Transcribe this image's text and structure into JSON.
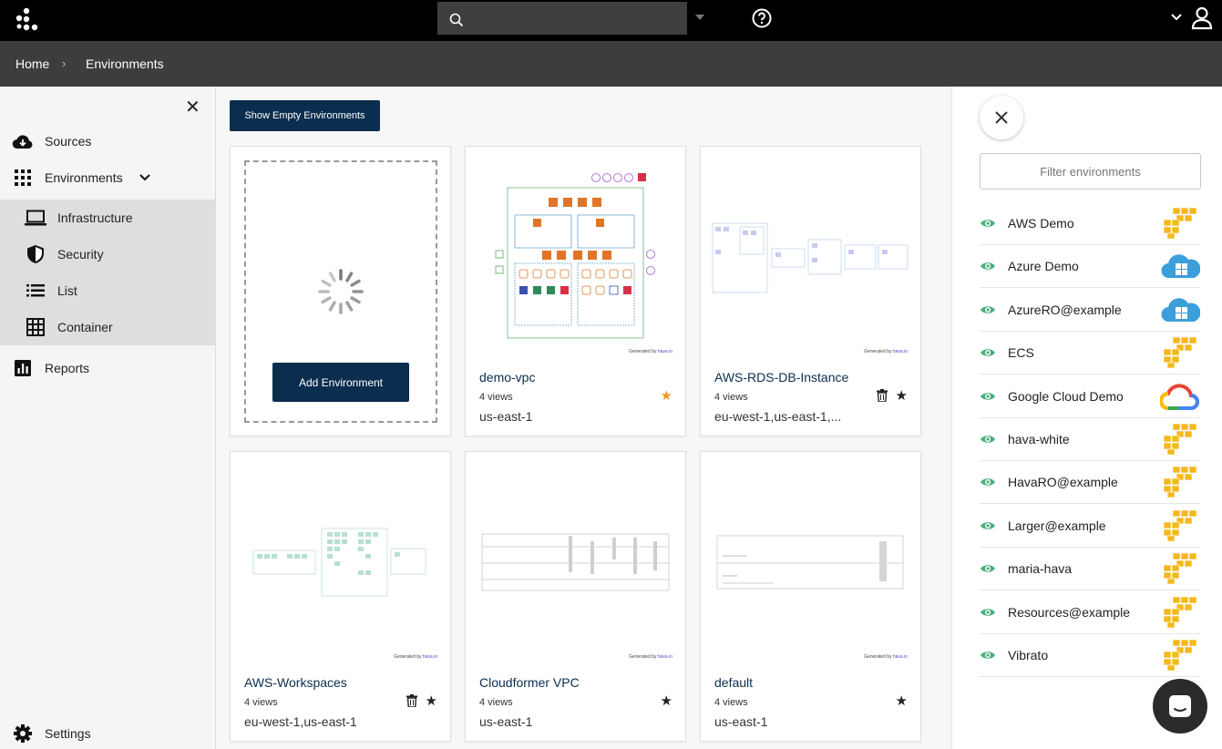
{
  "breadcrumb": {
    "home": "Home",
    "separator": "›",
    "current": "Environments"
  },
  "sidebar": {
    "items": [
      {
        "label": "Sources",
        "icon": "cloud-download-icon"
      },
      {
        "label": "Environments",
        "icon": "grid-icon"
      },
      {
        "label": "Infrastructure",
        "icon": "laptop-icon"
      },
      {
        "label": "Security",
        "icon": "shield-icon"
      },
      {
        "label": "List",
        "icon": "list-icon"
      },
      {
        "label": "Container",
        "icon": "container-grid-icon"
      },
      {
        "label": "Reports",
        "icon": "report-icon"
      },
      {
        "label": "Settings",
        "icon": "gear-icon"
      }
    ]
  },
  "toolbar": {
    "show_empty_label": "Show Empty Environments"
  },
  "add_card": {
    "button_label": "Add Environment"
  },
  "generated_by": {
    "prefix": "Generated by",
    "brand": "hava.io"
  },
  "cards": [
    {
      "name": "demo-vpc",
      "views": "4 views",
      "region": "us-east-1",
      "starred": true,
      "deletable": false
    },
    {
      "name": "AWS-RDS-DB-Instance",
      "views": "4 views",
      "region": "eu-west-1,us-east-1,...",
      "starred": false,
      "deletable": true
    },
    {
      "name": "AWS-Workspaces",
      "views": "4 views",
      "region": "eu-west-1,us-east-1",
      "starred": false,
      "deletable": true
    },
    {
      "name": "Cloudformer VPC",
      "views": "4 views",
      "region": "us-east-1",
      "starred": false,
      "deletable": false
    },
    {
      "name": "default",
      "views": "4 views",
      "region": "us-east-1",
      "starred": false,
      "deletable": false
    }
  ],
  "right_panel": {
    "filter_placeholder": "Filter environments",
    "environments": [
      {
        "name": "AWS Demo",
        "provider": "aws"
      },
      {
        "name": "Azure Demo",
        "provider": "azure"
      },
      {
        "name": "AzureRO@example",
        "provider": "azure"
      },
      {
        "name": "ECS",
        "provider": "aws"
      },
      {
        "name": "Google Cloud Demo",
        "provider": "gcp"
      },
      {
        "name": "hava-white",
        "provider": "aws"
      },
      {
        "name": "HavaRO@example",
        "provider": "aws"
      },
      {
        "name": "Larger@example",
        "provider": "aws"
      },
      {
        "name": "maria-hava",
        "provider": "aws"
      },
      {
        "name": "Resources@example",
        "provider": "aws"
      },
      {
        "name": "Vibrato",
        "provider": "aws"
      }
    ]
  },
  "colors": {
    "navy": "#0b2e4f",
    "eye_green": "#4caf7d",
    "star_orange": "#f0972a",
    "aws_yellow": "#f5b81c",
    "azure_blue": "#3b9fdc"
  }
}
